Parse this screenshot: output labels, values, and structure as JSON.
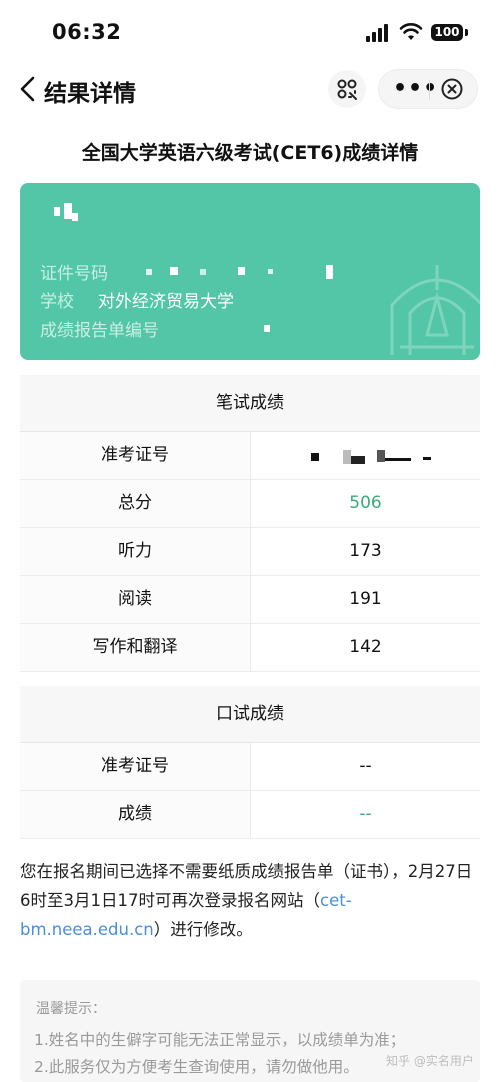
{
  "status_bar": {
    "time": "06:32",
    "battery": "100"
  },
  "nav": {
    "title": "结果详情"
  },
  "page_title": "全国大学英语六级考试(CET6)成绩详情",
  "card": {
    "id_label": "证件号码",
    "school_label": "学校",
    "school_value": "对外经济贸易大学",
    "report_label": "成绩报告单编号"
  },
  "written": {
    "header": "笔试成绩",
    "rows": [
      {
        "label": "准考证号",
        "value": ""
      },
      {
        "label": "总分",
        "value": "506"
      },
      {
        "label": "听力",
        "value": "173"
      },
      {
        "label": "阅读",
        "value": "191"
      },
      {
        "label": "写作和翻译",
        "value": "142"
      }
    ]
  },
  "oral": {
    "header": "口试成绩",
    "rows": [
      {
        "label": "准考证号",
        "value": "--"
      },
      {
        "label": "成绩",
        "value": "--"
      }
    ]
  },
  "notice": {
    "text_before": "您在报名期间已选择不需要纸质成绩报告单（证书），2月27日6时至3月1日17时可再次登录报名网站（",
    "link": "cet-bm.neea.edu.cn",
    "text_after": "）进行修改。"
  },
  "tips": {
    "title": "温馨提示：",
    "line1": "1.姓名中的生僻字可能无法正常显示，以成绩单为准；",
    "line2": "2.此服务仅为方便考生查询使用，请勿做他用。"
  },
  "watermark": "知乎 @实名用户",
  "colors": {
    "card_green": "#52c6a6",
    "score_green": "#3aa97a",
    "link_blue": "#4a8fd8"
  }
}
